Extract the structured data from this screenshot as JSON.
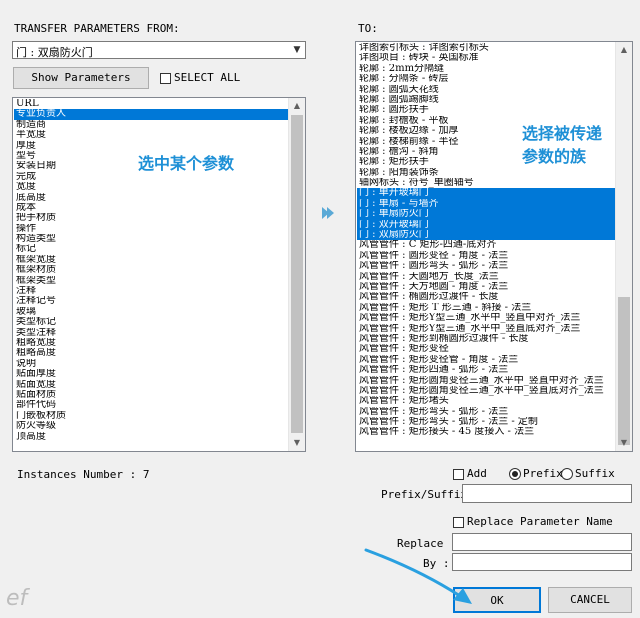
{
  "dialog": {
    "from_label": "TRANSFER PARAMETERS FROM:",
    "to_label": "TO:",
    "from_combo_value": "门 : 双扇防火门",
    "show_parameters_label": "Show Parameters",
    "select_all_label": "SELECT ALL",
    "instances_label": "Instances Number : 7",
    "add_label": "Add",
    "prefix_label": "Prefix",
    "suffix_label": "Suffix",
    "prefix_suffix_label": "Prefix/Suffix :",
    "replace_name_label": "Replace Parameter Name",
    "replace_label": "Replace :",
    "by_label": "By :",
    "ok_label": "OK",
    "cancel_label": "CANCEL",
    "prefix_suffix_value": "",
    "replace_value": "",
    "by_value": ""
  },
  "left_list": {
    "items": [
      {
        "text": "URL",
        "selected": false
      },
      {
        "text": "专业负责人",
        "selected": true
      },
      {
        "text": "制造商",
        "selected": false
      },
      {
        "text": "半宽度",
        "selected": false
      },
      {
        "text": "厚度",
        "selected": false
      },
      {
        "text": "型号",
        "selected": false
      },
      {
        "text": "安装日期",
        "selected": false
      },
      {
        "text": "完成",
        "selected": false
      },
      {
        "text": "宽度",
        "selected": false
      },
      {
        "text": "底高度",
        "selected": false
      },
      {
        "text": "成本",
        "selected": false
      },
      {
        "text": "把手材质",
        "selected": false
      },
      {
        "text": "操作",
        "selected": false
      },
      {
        "text": "构造类型",
        "selected": false
      },
      {
        "text": "标记",
        "selected": false
      },
      {
        "text": "框架宽度",
        "selected": false
      },
      {
        "text": "框架材质",
        "selected": false
      },
      {
        "text": "框架类型",
        "selected": false
      },
      {
        "text": "注释",
        "selected": false
      },
      {
        "text": "注释记号",
        "selected": false
      },
      {
        "text": "玻璃",
        "selected": false
      },
      {
        "text": "类型标记",
        "selected": false
      },
      {
        "text": "类型注释",
        "selected": false
      },
      {
        "text": "粗略宽度",
        "selected": false
      },
      {
        "text": "粗略高度",
        "selected": false
      },
      {
        "text": "说明",
        "selected": false
      },
      {
        "text": "贴面厚度",
        "selected": false
      },
      {
        "text": "贴面宽度",
        "selected": false
      },
      {
        "text": "贴面材质",
        "selected": false
      },
      {
        "text": "部件代码",
        "selected": false
      },
      {
        "text": "门嵌板材质",
        "selected": false
      },
      {
        "text": "防火等级",
        "selected": false
      },
      {
        "text": "顶高度",
        "selected": false
      }
    ]
  },
  "right_list": {
    "items": [
      {
        "text": "详图索引标头 : 详图索引标头",
        "selected": false
      },
      {
        "text": "详图项目 : 砖块 - 英国标准",
        "selected": false
      },
      {
        "text": "轮廓 : 2mm分隔缝",
        "selected": false
      },
      {
        "text": "轮廓 : 分隔条 - 砖层",
        "selected": false
      },
      {
        "text": "轮廓 : 圆弧天花线",
        "selected": false
      },
      {
        "text": "轮廓 : 圆弧踢脚线",
        "selected": false
      },
      {
        "text": "轮廓 : 圆形扶手",
        "selected": false
      },
      {
        "text": "轮廓 : 封檐板 - 平板",
        "selected": false
      },
      {
        "text": "轮廓 : 楼板边缘 - 加厚",
        "selected": false
      },
      {
        "text": "轮廓 : 楼梯前缘 - 半径",
        "selected": false
      },
      {
        "text": "轮廓 : 檐沟 - 斜角",
        "selected": false
      },
      {
        "text": "轮廓 : 矩形扶手",
        "selected": false
      },
      {
        "text": "轮廓 : 阳角装饰条",
        "selected": false
      },
      {
        "text": "轴网标头 : 符号_单圈轴号",
        "selected": false
      },
      {
        "text": "门 : 单开玻璃门",
        "selected": true
      },
      {
        "text": "门 : 单扇 - 与墙齐",
        "selected": true
      },
      {
        "text": "门 : 单扇防火门",
        "selected": true
      },
      {
        "text": "门 : 双开玻璃门",
        "selected": true
      },
      {
        "text": "门 : 双扇防火门",
        "selected": true
      },
      {
        "text": "风管管件 : C 矩形-四通-底对齐",
        "selected": false
      },
      {
        "text": "风管管件 : 圆形变径 - 角度 - 法兰",
        "selected": false
      },
      {
        "text": "风管管件 : 圆形弯头 - 弧形 - 法兰",
        "selected": false
      },
      {
        "text": "风管管件 : 天圆地方_长度_法兰",
        "selected": false
      },
      {
        "text": "风管管件 : 天方地圆 - 角度 - 法兰",
        "selected": false
      },
      {
        "text": "风管管件 : 椭圆形过渡件 - 长度",
        "selected": false
      },
      {
        "text": "风管管件 : 矩形 T 形三通 - 斜接 - 法兰",
        "selected": false
      },
      {
        "text": "风管管件 : 矩形Y型三通_水平中_竖直中对齐_法兰",
        "selected": false
      },
      {
        "text": "风管管件 : 矩形Y型三通_水平中_竖直底对齐_法兰",
        "selected": false
      },
      {
        "text": "风管管件 : 矩形到椭圆形过渡件 - 长度",
        "selected": false
      },
      {
        "text": "风管管件 : 矩形变径",
        "selected": false
      },
      {
        "text": "风管管件 : 矩形变径管 - 角度 - 法兰",
        "selected": false
      },
      {
        "text": "风管管件 : 矩形四通 - 弧形 - 法兰",
        "selected": false
      },
      {
        "text": "风管管件 : 矩形圆角变径三通_水平中_竖直中对齐_法兰",
        "selected": false
      },
      {
        "text": "风管管件 : 矩形圆角变径三通_水平中_竖直底对齐_法兰",
        "selected": false
      },
      {
        "text": "风管管件 : 矩形堵头",
        "selected": false
      },
      {
        "text": "风管管件 : 矩形弯头 - 弧形 - 法兰",
        "selected": false
      },
      {
        "text": "风管管件 : 矩形弯头 - 弧形 - 法兰 - 定制",
        "selected": false
      },
      {
        "text": "风管管件 : 矩形接头 - 45 度接入 - 法兰",
        "selected": false
      }
    ]
  },
  "annotations": {
    "left_note": "选中某个参数",
    "right_note_line1": "选择被传递",
    "right_note_line2": "参数的族",
    "watermark": "ef"
  },
  "colors": {
    "selection": "#0078d7",
    "annotation": "#1e90d6",
    "arrow": "#2aa0e0"
  }
}
